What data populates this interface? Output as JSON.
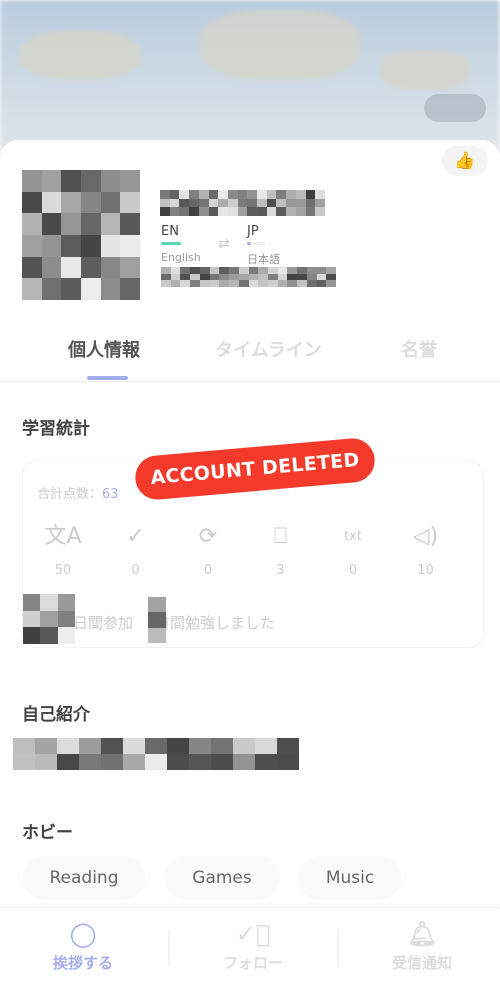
{
  "profile": {
    "native_lang": {
      "code": "EN",
      "name": "English",
      "color": "#5fd6b2"
    },
    "target_lang": {
      "code": "JP",
      "name": "日本語",
      "color": "#a4acee"
    }
  },
  "tabs": [
    {
      "label": "個人情報",
      "active": true
    },
    {
      "label": "タイムライン"
    },
    {
      "label": "名誉"
    }
  ],
  "stats": {
    "title": "学習統計",
    "total_label": "合計点数：",
    "total_value": "63",
    "items": [
      {
        "icon": "translate-icon",
        "value": "50"
      },
      {
        "icon": "abc-check-icon",
        "value": "0"
      },
      {
        "icon": "refresh-icon",
        "value": "0"
      },
      {
        "icon": "bookmark-icon",
        "value": "3"
      },
      {
        "icon": "audio-text-icon",
        "value": "0"
      },
      {
        "icon": "speaker-icon",
        "value": "10"
      }
    ],
    "days_joined": "日間参加",
    "days_studied": "日間勉強しました"
  },
  "banner": "ACCOUNT DELETED",
  "intro": {
    "title": "自己紹介"
  },
  "hobby": {
    "title": "ホビー",
    "items": [
      "Reading",
      "Games",
      "Music"
    ]
  },
  "bottom_nav": [
    {
      "label": "挨拶する",
      "icon": "chat-bubble-icon",
      "active": true,
      "color": "#a4acee"
    },
    {
      "label": "フォロー",
      "icon": "check-circle-icon"
    },
    {
      "label": "受信通知",
      "icon": "bell-icon"
    }
  ]
}
